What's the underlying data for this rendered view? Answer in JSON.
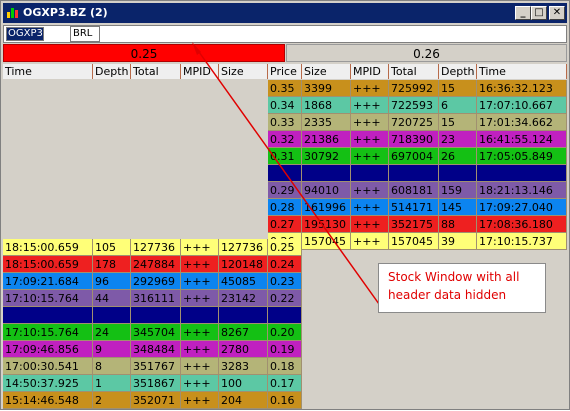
{
  "window": {
    "title": "OGXP3.BZ (2)"
  },
  "title_buttons": {
    "minimize": "_",
    "maximize": "□",
    "close": "✕"
  },
  "toolbar": {
    "symbol": "OGXP3",
    "exchange": "BRL"
  },
  "best": {
    "bid": "0.25",
    "ask": "0.26"
  },
  "columns": {
    "bid": [
      "Time",
      "Depth",
      "Total",
      "MPID",
      "Size"
    ],
    "ask": [
      "Price",
      "Size",
      "MPID",
      "Total",
      "Depth",
      "Time"
    ]
  },
  "asks": [
    {
      "price": "0.35",
      "size": "3399",
      "mpid": "+++",
      "total": "725992",
      "depth": "15",
      "time": "16:36:32.123",
      "bg": "#c8901c",
      "fg": "#000000"
    },
    {
      "price": "0.34",
      "size": "1868",
      "mpid": "+++",
      "total": "722593",
      "depth": "6",
      "time": "17:07:10.667",
      "bg": "#5cc8a4",
      "fg": "#000000"
    },
    {
      "price": "0.33",
      "size": "2335",
      "mpid": "+++",
      "total": "720725",
      "depth": "15",
      "time": "17:01:34.662",
      "bg": "#b4b478",
      "fg": "#000000"
    },
    {
      "price": "0.32",
      "size": "21386",
      "mpid": "+++",
      "total": "718390",
      "depth": "23",
      "time": "16:41:55.124",
      "bg": "#c020c0",
      "fg": "#000000"
    },
    {
      "price": "0.31",
      "size": "30792",
      "mpid": "+++",
      "total": "697004",
      "depth": "26",
      "time": "17:05:05.849",
      "bg": "#14c014",
      "fg": "#000000"
    },
    {
      "price": "",
      "size": "",
      "mpid": "",
      "total": "",
      "depth": "",
      "time": "",
      "bg": "#000088",
      "fg": "#000000"
    },
    {
      "price": "0.29",
      "size": "94010",
      "mpid": "+++",
      "total": "608181",
      "depth": "159",
      "time": "18:21:13.146",
      "bg": "#7e5aa8",
      "fg": "#000000"
    },
    {
      "price": "0.28",
      "size": "161996",
      "mpid": "+++",
      "total": "514171",
      "depth": "145",
      "time": "17:09:27.040",
      "bg": "#0c84f0",
      "fg": "#000000"
    },
    {
      "price": "0.27",
      "size": "195130",
      "mpid": "+++",
      "total": "352175",
      "depth": "88",
      "time": "17:08:36.180",
      "bg": "#ee2020",
      "fg": "#000000"
    },
    {
      "price": "0.26",
      "size": "157045",
      "mpid": "+++",
      "total": "157045",
      "depth": "39",
      "time": "17:10:15.737",
      "bg": "#ffff78",
      "fg": "#000000"
    }
  ],
  "bids": [
    {
      "time": "18:15:00.659",
      "depth": "105",
      "total": "127736",
      "mpid": "+++",
      "size": "127736",
      "price": "0.25",
      "bg": "#ffff78",
      "fg": "#000000"
    },
    {
      "time": "18:15:00.659",
      "depth": "178",
      "total": "247884",
      "mpid": "+++",
      "size": "120148",
      "price": "0.24",
      "bg": "#ee2020",
      "fg": "#000000"
    },
    {
      "time": "17:09:21.684",
      "depth": "96",
      "total": "292969",
      "mpid": "+++",
      "size": "45085",
      "price": "0.23",
      "bg": "#0c84f0",
      "fg": "#000000"
    },
    {
      "time": "17:10:15.764",
      "depth": "44",
      "total": "316111",
      "mpid": "+++",
      "size": "23142",
      "price": "0.22",
      "bg": "#7e5aa8",
      "fg": "#000000"
    },
    {
      "time": "",
      "depth": "",
      "total": "",
      "mpid": "",
      "size": "",
      "price": "",
      "bg": "#000088",
      "fg": "#000000"
    },
    {
      "time": "17:10:15.764",
      "depth": "24",
      "total": "345704",
      "mpid": "+++",
      "size": "8267",
      "price": "0.20",
      "bg": "#14c014",
      "fg": "#000000"
    },
    {
      "time": "17:09:46.856",
      "depth": "9",
      "total": "348484",
      "mpid": "+++",
      "size": "2780",
      "price": "0.19",
      "bg": "#c020c0",
      "fg": "#000000"
    },
    {
      "time": "17:00:30.541",
      "depth": "8",
      "total": "351767",
      "mpid": "+++",
      "size": "3283",
      "price": "0.18",
      "bg": "#b4b478",
      "fg": "#000000"
    },
    {
      "time": "14:50:37.925",
      "depth": "1",
      "total": "351867",
      "mpid": "+++",
      "size": "100",
      "price": "0.17",
      "bg": "#5cc8a4",
      "fg": "#000000"
    },
    {
      "time": "15:14:46.548",
      "depth": "2",
      "total": "352071",
      "mpid": "+++",
      "size": "204",
      "price": "0.16",
      "bg": "#c8901c",
      "fg": "#000000"
    }
  ],
  "annotation": {
    "line1": "Stock Window with all",
    "line2": "header data hidden"
  },
  "colors": {
    "annotation": "#e00000",
    "title_bar": "#0a246a"
  }
}
